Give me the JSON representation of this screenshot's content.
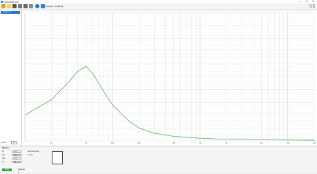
{
  "window": {
    "title": "SPEAKER SIM",
    "minimize": "—",
    "maximize": "☐",
    "close": "✕"
  },
  "toolbar": {
    "freq_text": "Freq plot - 1/1 (dB Eq)",
    "status_line1": "2.4 kHz",
    "status_line2": "0.0 dB"
  },
  "sidebar": {
    "item": "Speaker 1",
    "bottom_label": "Smooth",
    "bottom_value": "1/1"
  },
  "chart_data": {
    "type": "line",
    "title": "",
    "xlabel": "",
    "ylabel": "",
    "xscale": "log",
    "xlim": [
      10,
      20000
    ],
    "ylim": [
      0,
      100
    ],
    "grid": true,
    "x_tick_labels": [
      "20",
      "50",
      "100",
      "200",
      "500",
      "1k",
      "2k",
      "5k",
      "10k",
      "20k"
    ],
    "series": [
      {
        "color": "#4caf50",
        "points": [
          [
            10,
            20
          ],
          [
            20,
            32
          ],
          [
            30,
            44
          ],
          [
            40,
            54
          ],
          [
            50,
            58
          ],
          [
            60,
            52
          ],
          [
            80,
            38
          ],
          [
            100,
            28
          ],
          [
            150,
            16
          ],
          [
            200,
            10
          ],
          [
            300,
            6
          ],
          [
            500,
            3.5
          ],
          [
            1000,
            2
          ],
          [
            2000,
            1.2
          ],
          [
            5000,
            0.8
          ],
          [
            20000,
            0.5
          ]
        ]
      }
    ]
  },
  "bottom": {
    "section_title": "Options",
    "fields": [
      {
        "label": "Fs",
        "value": "28.0"
      },
      {
        "label": "Qts",
        "value": "0.42"
      },
      {
        "label": "Vas",
        "value": "12.3"
      },
      {
        "label": "Re",
        "value": "5.8"
      }
    ],
    "right_label": "Box Enclosure",
    "checkbox_label": "Vent",
    "ok_button": "Apply",
    "mode": "Standard ▾"
  },
  "colors": {
    "accent": "#1f76d0",
    "ok": "#2ea043",
    "curve": "#4caf50"
  }
}
